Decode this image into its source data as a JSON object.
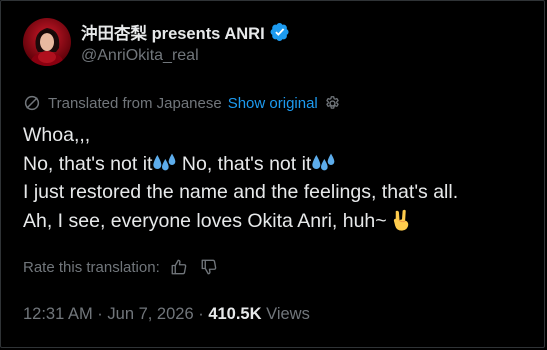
{
  "tweet": {
    "author": {
      "display_name": "沖田杏梨 presents ANRI",
      "handle": "@AnriOkita_real",
      "verified_icon": "verified-badge-icon",
      "avatar_icon": "avatar"
    },
    "translation": {
      "notice": "Translated from Japanese",
      "show_original": "Show original"
    },
    "lines": {
      "l1": "Whoa,,,",
      "l2a": "No, that's not it",
      "l2b": " No, that's not it",
      "l3": "I just restored the name and the feelings, that's all.",
      "l4": "Ah, I see, everyone loves Okita Anri, huh~"
    },
    "emoji": {
      "sweat": "sweat-droplets-emoji",
      "horns": "sign-of-the-horns-emoji"
    },
    "rate": {
      "label": "Rate this translation:"
    },
    "meta": {
      "time": "12:31 AM",
      "sep1": " · ",
      "date": "Jun 7, 2026",
      "sep2": " · ",
      "views_count": "410.5K",
      "views_label": " Views"
    }
  },
  "colors": {
    "background": "#000000",
    "text": "#e7e9ea",
    "muted": "#71767b",
    "link": "#1d9bf0",
    "border": "#2f3336"
  }
}
